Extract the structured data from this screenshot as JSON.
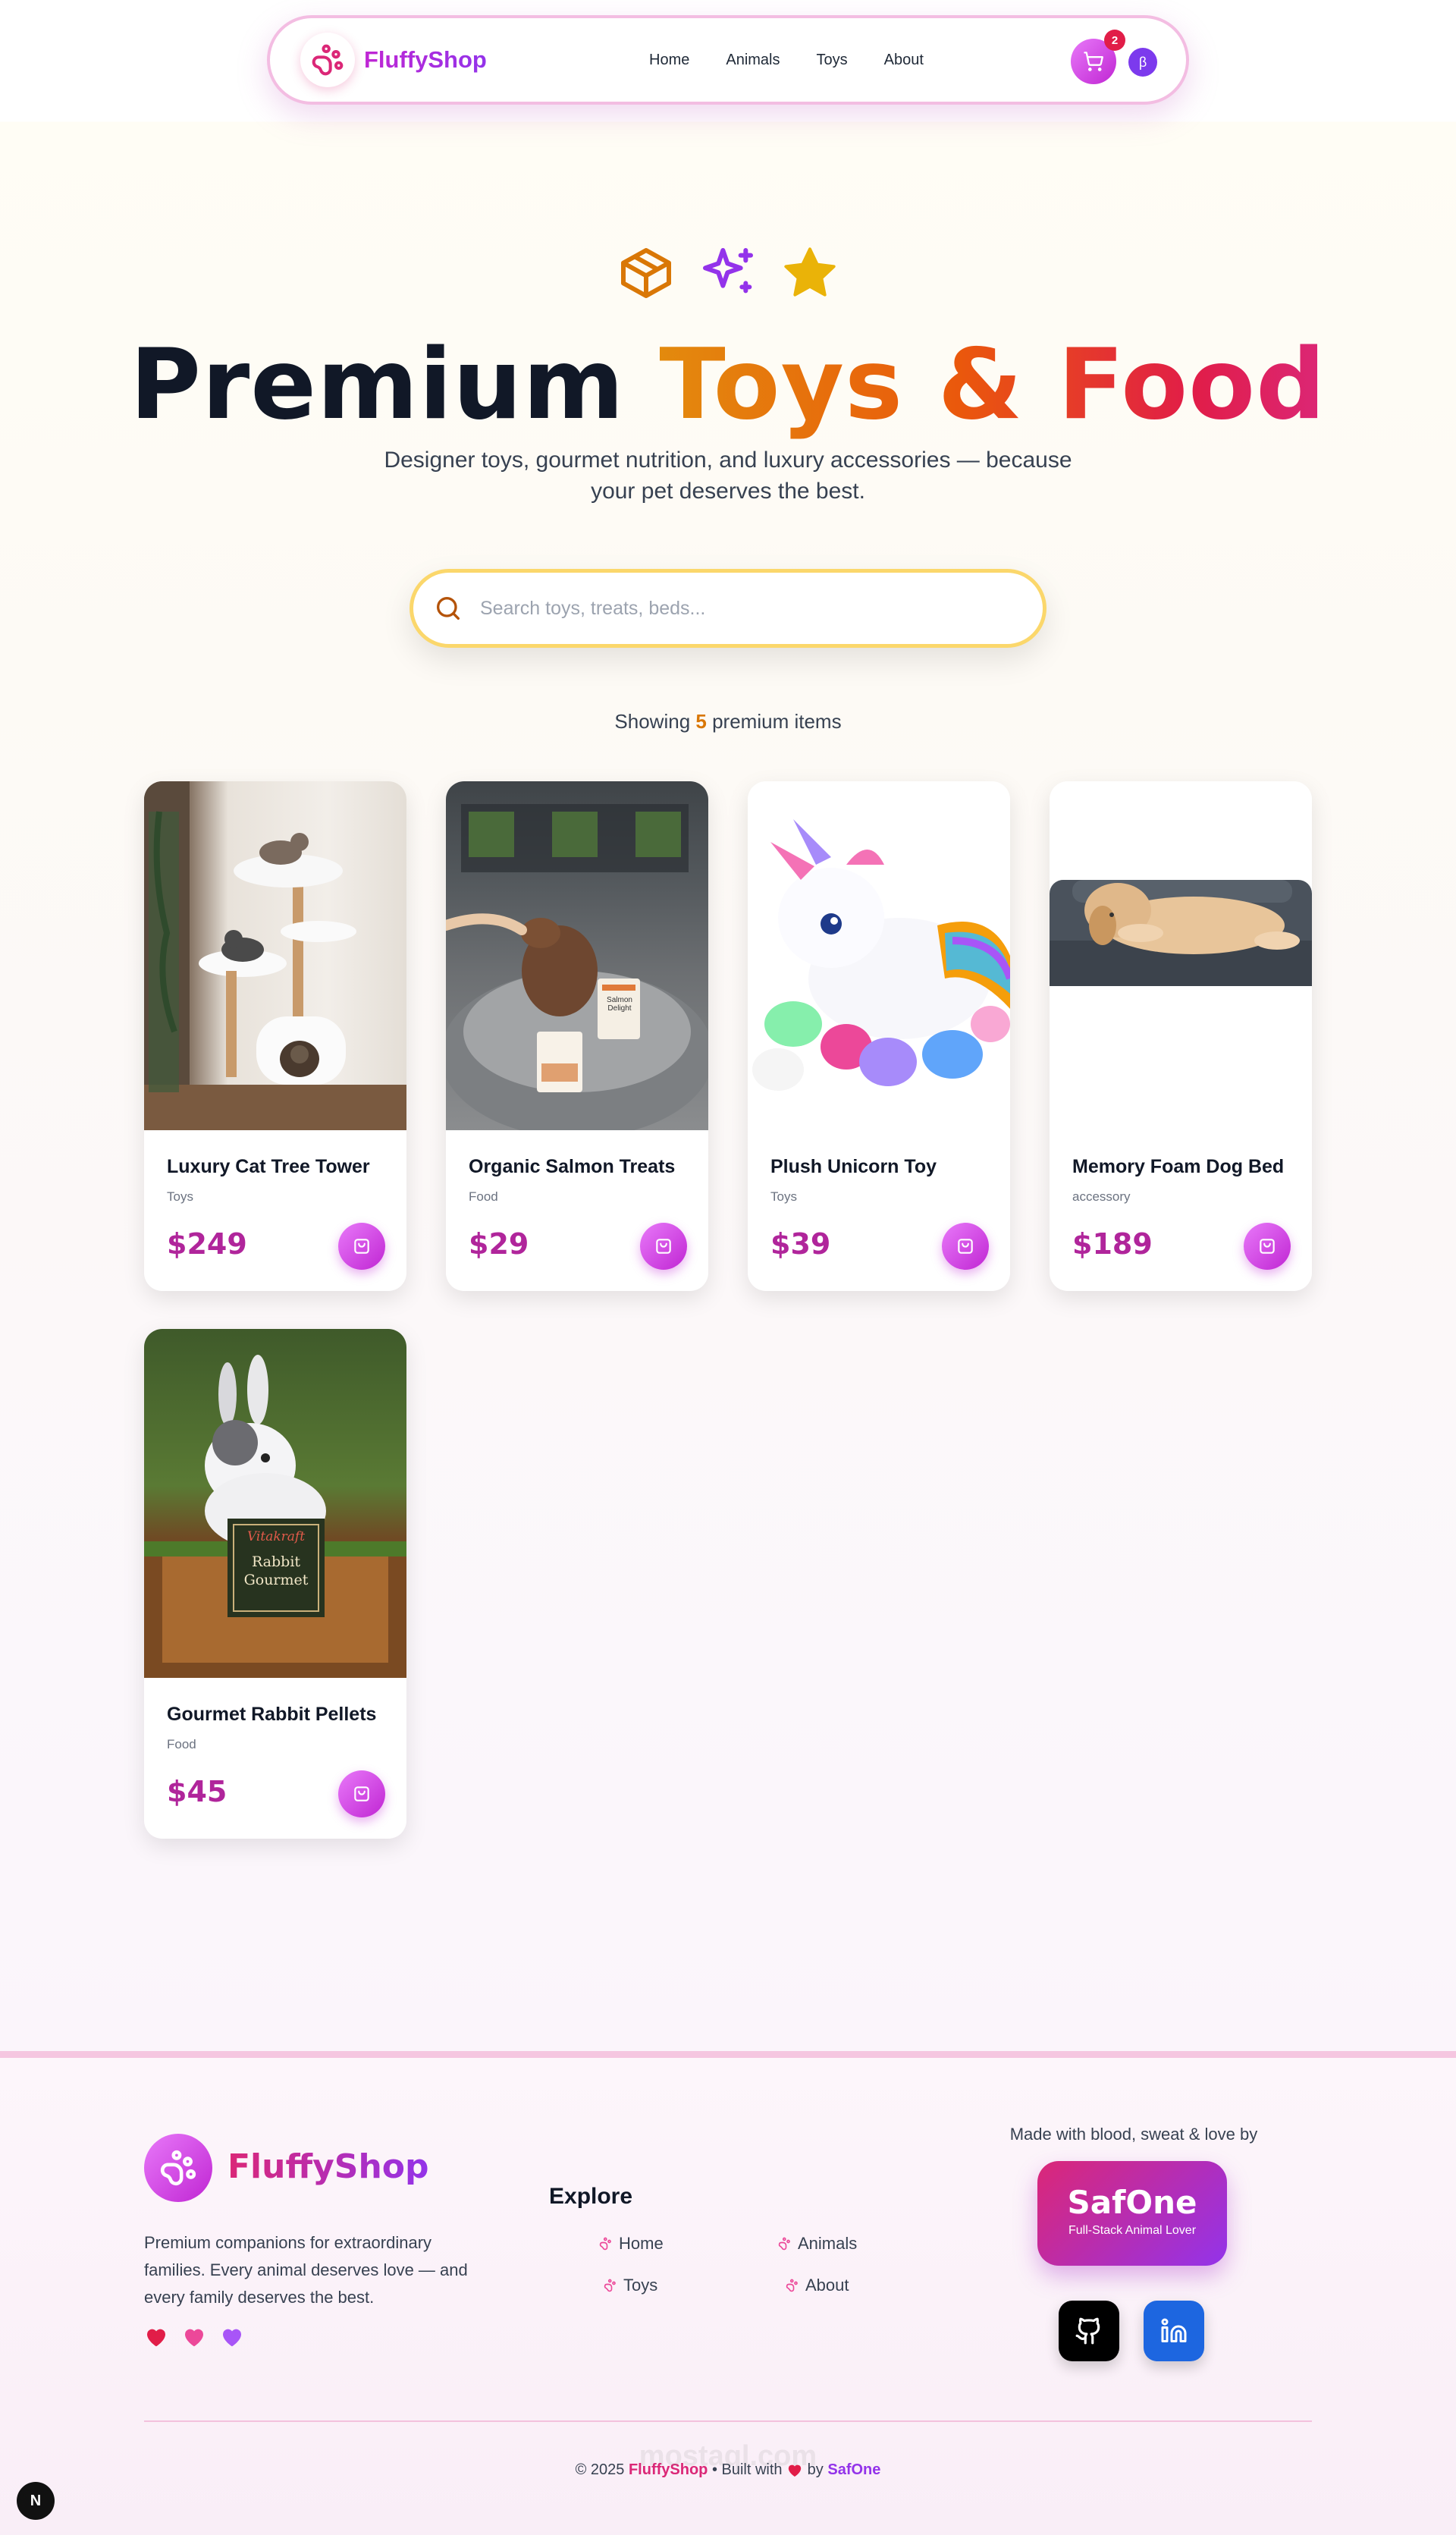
{
  "nav": {
    "brand": "FluffyShop",
    "links": [
      "Home",
      "Animals",
      "Toys",
      "About"
    ],
    "cart_count": "2",
    "beta_label": "β"
  },
  "hero": {
    "title_part1": "Premium",
    "title_part2": "Toys & Food",
    "subtitle": "Designer toys, gourmet nutrition, and luxury accessories — because your pet deserves the best.",
    "icons": [
      "box-icon",
      "sparkles-icon",
      "star-icon"
    ]
  },
  "search": {
    "placeholder": "Search toys, treats, beds..."
  },
  "results": {
    "prefix": "Showing",
    "count": "5",
    "suffix": "premium items"
  },
  "products": [
    {
      "name": "Luxury Cat Tree Tower",
      "category": "Toys",
      "price": "$249"
    },
    {
      "name": "Organic Salmon Treats",
      "category": "Food",
      "price": "$29"
    },
    {
      "name": "Plush Unicorn Toy",
      "category": "Toys",
      "price": "$39"
    },
    {
      "name": "Memory Foam Dog Bed",
      "category": "accessory",
      "price": "$189"
    },
    {
      "name": "Gourmet Rabbit Pellets",
      "category": "Food",
      "price": "$45"
    }
  ],
  "product_image_text": {
    "salmon_pack": "Salmon Delight",
    "rabbit_bag_brand": "Vitakraft",
    "rabbit_bag_line1": "Rabbit",
    "rabbit_bag_line2": "Gourmet"
  },
  "footer": {
    "brand": "FluffyShop",
    "description": "Premium companions for extraordinary families. Every animal deserves love — and every family deserves the best.",
    "explore_title": "Explore",
    "links": [
      "Home",
      "Animals",
      "Toys",
      "About"
    ],
    "made_with": "Made with blood, sweat & love by",
    "author": "SafOne",
    "author_tagline": "Full-Stack Animal Lover",
    "copy_prefix": "© 2025",
    "copy_brand": "FluffyShop",
    "copy_middle": "• Built with",
    "copy_by": "by",
    "copy_author": "SafOne"
  },
  "colors": {
    "brand_pink": "#c026d3",
    "accent_orange": "#ea580c",
    "search_border": "#fbd76b",
    "price": "#b0259b"
  },
  "watermark": "mostaql.com"
}
